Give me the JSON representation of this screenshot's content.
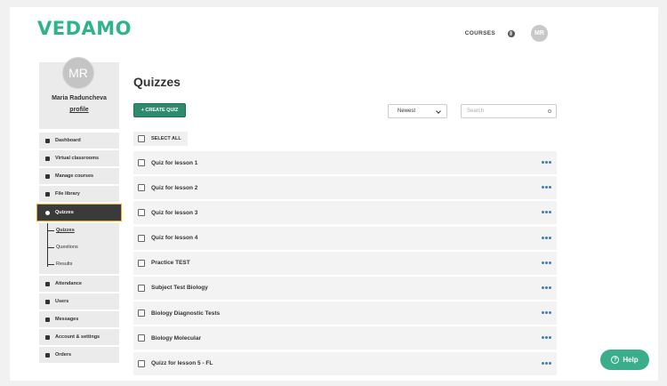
{
  "header": {
    "logo": "VEDAMO",
    "courses_link": "COURSES",
    "globe_icon": "globe-icon",
    "user_initials": "MR"
  },
  "profile": {
    "initials": "MR",
    "name": "Maria Raduncheva",
    "link": "profile"
  },
  "sidebar": {
    "items": [
      {
        "label": "Dashboard",
        "icon": "dashboard-icon"
      },
      {
        "label": "Virtual classrooms",
        "icon": "gear-icon"
      },
      {
        "label": "Manage courses",
        "icon": "book-icon"
      },
      {
        "label": "File library",
        "icon": "cloud-icon"
      },
      {
        "label": "Quizzes",
        "icon": "question-icon",
        "active": true
      },
      {
        "label": "Attendance",
        "icon": "document-icon"
      },
      {
        "label": "Users",
        "icon": "users-icon"
      },
      {
        "label": "Messages",
        "icon": "envelope-icon"
      },
      {
        "label": "Account & settings",
        "icon": "gear-icon"
      },
      {
        "label": "Orders",
        "icon": "cart-icon"
      }
    ],
    "subitems": [
      "Quizzes",
      "Questions",
      "Results"
    ]
  },
  "main": {
    "title": "Quizzes",
    "create_button": "+ CREATE QUIZ",
    "sort_value": "Newest",
    "search_placeholder": "Search",
    "select_all": "SELECT ALL",
    "quizzes": [
      "Quiz for lesson 1",
      "Quiz for lesson 2",
      "Quiz for lesson 3",
      "Quiz for lesson 4",
      "Practice TEST",
      "Subject Test Biology",
      "Biology Diagnostic Tests",
      "Biology Molecular",
      "Quizz for lesson 5 - FL"
    ]
  },
  "help": {
    "label": "Help"
  },
  "colors": {
    "brand": "#2fb38a",
    "active_nav": "#3a3a3a",
    "highlight": "#f5a623",
    "create_button": "#2e8b6e",
    "menu_dots": "#3f7cc4"
  }
}
